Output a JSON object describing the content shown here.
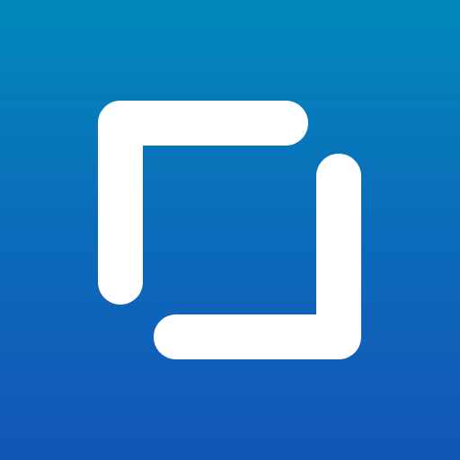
{
  "icon": {
    "name": "square-frame-icon",
    "colors": {
      "gradient_top": "#0089BA",
      "gradient_middle": "#0B6EBA",
      "gradient_bottom": "#1255B8",
      "glyph": "#FFFFFF"
    }
  }
}
